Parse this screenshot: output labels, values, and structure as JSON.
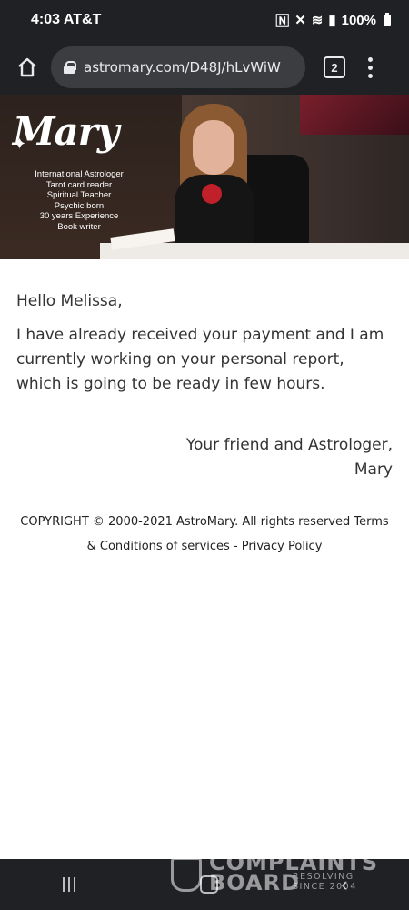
{
  "status_bar": {
    "time_carrier": "4:03 AT&T",
    "battery": "100%"
  },
  "browser": {
    "url": "astromary.com/D48J/hLvWiW",
    "tab_count": "2"
  },
  "banner": {
    "logo": "Mary",
    "lines": [
      "International Astrologer",
      "Tarot card reader",
      "Spiritual Teacher",
      "Psychic born",
      "30 years Experience",
      "Book writer"
    ]
  },
  "email": {
    "greeting": "Hello Melissa,",
    "message": "I have already received your payment and I am currently working on your personal report, which is going to be ready in few hours.",
    "signature_line1": "Your friend and Astrologer,",
    "signature_line2": "Mary"
  },
  "footer": {
    "copyright": "COPYRIGHT © 2000-2021 AstroMary. All rights reserved",
    "terms": "Terms & Conditions of services",
    "separator": "-",
    "privacy": "Privacy Policy"
  },
  "watermark": {
    "line1": "COMPLAINTS",
    "line2": "BOARD",
    "line3": "RESOLVING SINCE 2004"
  }
}
